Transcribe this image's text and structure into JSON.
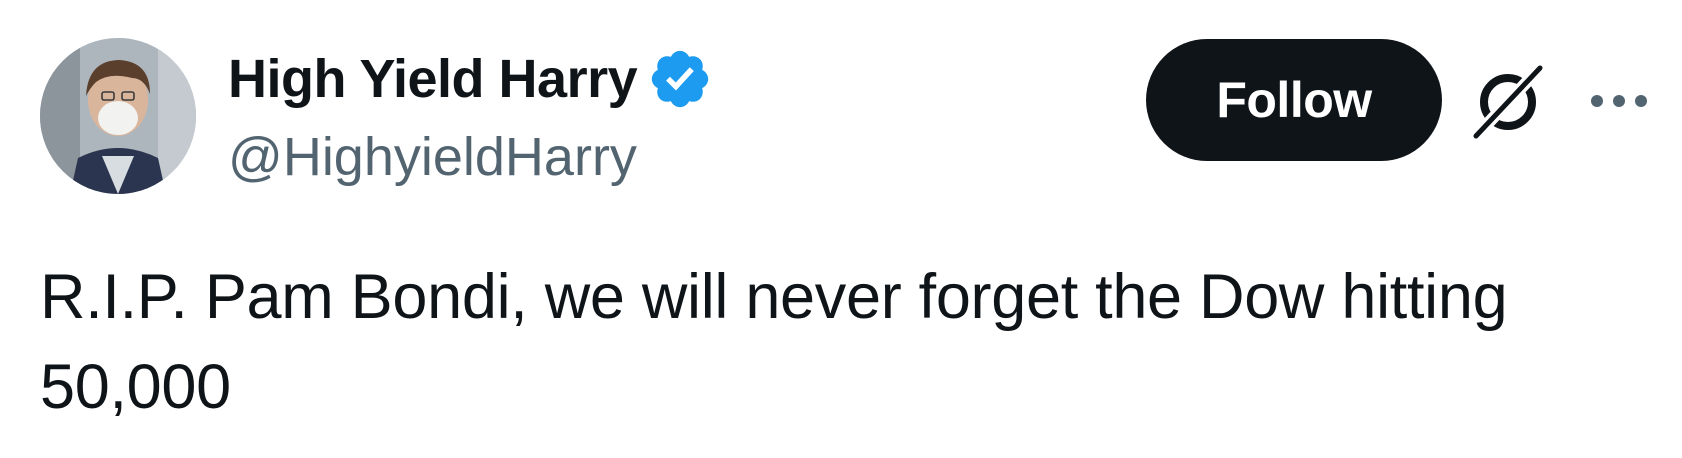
{
  "author": {
    "display_name": "High Yield Harry",
    "handle": "@HighyieldHarry",
    "verified": true,
    "verified_color": "#1d9bf0"
  },
  "actions": {
    "follow_label": "Follow",
    "grok_icon": "grok-icon",
    "more_icon": "more-horizontal-icon"
  },
  "tweet": {
    "text": "R.I.P. Pam Bondi, we will never forget the Dow hitting 50,000"
  },
  "colors": {
    "text_primary": "#0f1419",
    "text_secondary": "#536471",
    "button_bg": "#0f1419",
    "button_text": "#ffffff",
    "background": "#ffffff"
  }
}
